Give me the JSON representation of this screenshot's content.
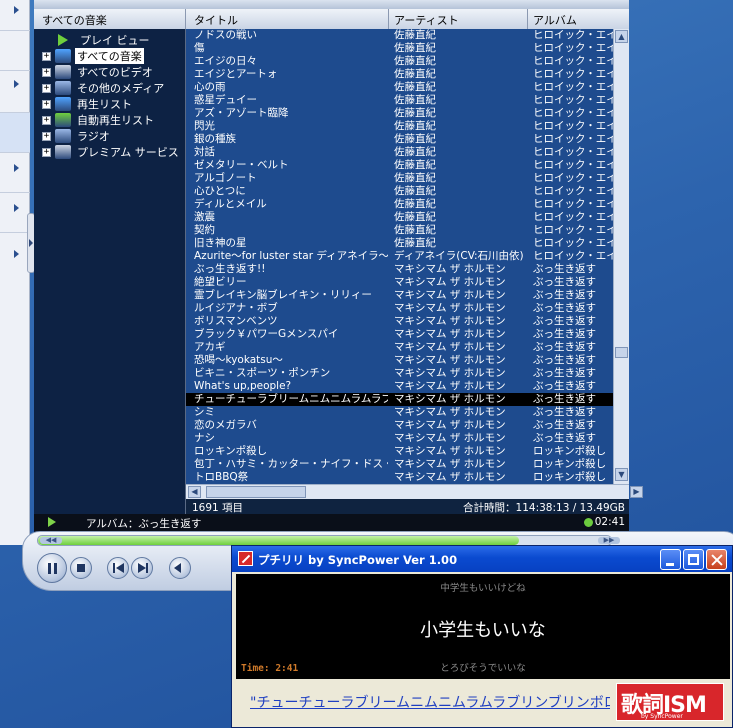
{
  "tree": {
    "header": "すべての音楽",
    "items": [
      {
        "label": "プレイ ビュー",
        "icon": "play-view-icon",
        "expand": false,
        "selected": false
      },
      {
        "label": "すべての音楽",
        "icon": "music-note-icon",
        "expand": true,
        "selected": true
      },
      {
        "label": "すべてのビデオ",
        "icon": "film-icon",
        "expand": true,
        "selected": false
      },
      {
        "label": "その他のメディア",
        "icon": "media-icon",
        "expand": true,
        "selected": false
      },
      {
        "label": "再生リスト",
        "icon": "playlist-icon",
        "expand": true,
        "selected": false
      },
      {
        "label": "自動再生リスト",
        "icon": "auto-playlist-icon",
        "expand": true,
        "selected": false
      },
      {
        "label": "ラジオ",
        "icon": "radio-icon",
        "expand": true,
        "selected": false
      },
      {
        "label": "プレミアム サービス",
        "icon": "premium-services-icon",
        "expand": true,
        "selected": false
      }
    ]
  },
  "columns": {
    "title": "タイトル",
    "artist": "アーティスト",
    "album": "アルバム"
  },
  "rows": [
    {
      "title": "ノドスの戦い",
      "artist": "佐藤直紀",
      "album": "ヒロイック・エイジ"
    },
    {
      "title": "傷",
      "artist": "佐藤直紀",
      "album": "ヒロイック・エイジ"
    },
    {
      "title": "エイジの日々",
      "artist": "佐藤直紀",
      "album": "ヒロイック・エイジ"
    },
    {
      "title": "エイジとアートォ",
      "artist": "佐藤直紀",
      "album": "ヒロイック・エイジ"
    },
    {
      "title": "心の雨",
      "artist": "佐藤直紀",
      "album": "ヒロイック・エイジ"
    },
    {
      "title": "惑星デュイー",
      "artist": "佐藤直紀",
      "album": "ヒロイック・エイジ"
    },
    {
      "title": "アズ・アゾート臨降",
      "artist": "佐藤直紀",
      "album": "ヒロイック・エイジ"
    },
    {
      "title": "閃光",
      "artist": "佐藤直紀",
      "album": "ヒロイック・エイジ"
    },
    {
      "title": "銀の種族",
      "artist": "佐藤直紀",
      "album": "ヒロイック・エイジ"
    },
    {
      "title": "対話",
      "artist": "佐藤直紀",
      "album": "ヒロイック・エイジ"
    },
    {
      "title": "ゼメタリー・ベルト",
      "artist": "佐藤直紀",
      "album": "ヒロイック・エイジ"
    },
    {
      "title": "アルゴノート",
      "artist": "佐藤直紀",
      "album": "ヒロイック・エイジ"
    },
    {
      "title": "心ひとつに",
      "artist": "佐藤直紀",
      "album": "ヒロイック・エイジ"
    },
    {
      "title": "ディルとメイル",
      "artist": "佐藤直紀",
      "album": "ヒロイック・エイジ"
    },
    {
      "title": "激震",
      "artist": "佐藤直紀",
      "album": "ヒロイック・エイジ"
    },
    {
      "title": "契約",
      "artist": "佐藤直紀",
      "album": "ヒロイック・エイジ"
    },
    {
      "title": "旧き神の星",
      "artist": "佐藤直紀",
      "album": "ヒロイック・エイジ"
    },
    {
      "title": "Azurite～for luster star ディアネイラ～",
      "artist": "ディアネイラ(CV:石川由依)",
      "album": "ヒロイック・エイジ"
    },
    {
      "title": "ぶっ生き返す!!",
      "artist": "マキシマム ザ ホルモン",
      "album": "ぶっ生き返す"
    },
    {
      "title": "絶望ビリー",
      "artist": "マキシマム ザ ホルモン",
      "album": "ぶっ生き返す"
    },
    {
      "title": "霊ブレイキン脳ブレイキン・リリィー",
      "artist": "マキシマム ザ ホルモン",
      "album": "ぶっ生き返す"
    },
    {
      "title": "ルイジアナ・ボブ",
      "artist": "マキシマム ザ ホルモン",
      "album": "ぶっ生き返す"
    },
    {
      "title": "ボリスマンベンツ",
      "artist": "マキシマム ザ ホルモン",
      "album": "ぶっ生き返す"
    },
    {
      "title": "ブラック￥パワーGメンスパイ",
      "artist": "マキシマム ザ ホルモン",
      "album": "ぶっ生き返す"
    },
    {
      "title": "アカギ",
      "artist": "マキシマム ザ ホルモン",
      "album": "ぶっ生き返す"
    },
    {
      "title": "恐喝～kyokatsu～",
      "artist": "マキシマム ザ ホルモン",
      "album": "ぶっ生き返す"
    },
    {
      "title": "ビキニ・スポーツ・ポンチン",
      "artist": "マキシマム ザ ホルモン",
      "album": "ぶっ生き返す"
    },
    {
      "title": "What's up,people?",
      "artist": "マキシマム ザ ホルモン",
      "album": "ぶっ生き返す"
    },
    {
      "title": "チューチューラブリームニムニムラムラブリ…",
      "artist": "マキシマム ザ ホルモン",
      "album": "ぶっ生き返す"
    },
    {
      "title": "シミ",
      "artist": "マキシマム ザ ホルモン",
      "album": "ぶっ生き返す"
    },
    {
      "title": "恋のメガラバ",
      "artist": "マキシマム ザ ホルモン",
      "album": "ぶっ生き返す"
    },
    {
      "title": "ナシ",
      "artist": "マキシマム ザ ホルモン",
      "album": "ぶっ生き返す"
    },
    {
      "title": "ロッキンポ殺し",
      "artist": "マキシマム ザ ホルモン",
      "album": "ロッキンポ殺し"
    },
    {
      "title": "包丁・ハサミ・カッター・ナイフ・ドス・キリ",
      "artist": "マキシマム ザ ホルモン",
      "album": "ロッキンポ殺し"
    },
    {
      "title": "トロBBQ祭",
      "artist": "マキシマム ザ ホルモン",
      "album": "ロッキンポ殺し"
    }
  ],
  "current_row": 28,
  "status": {
    "count": "1691 項目",
    "total": "合計時間：114:38:13 / 13.49GB"
  },
  "now_playing": {
    "info": "アルバム：ぶっ生き返す",
    "time": "02:41",
    "progress": 0.84
  },
  "popup": {
    "title": "プチリリ by SyncPower Ver 1.00",
    "prev_line": "中学生もいいけどね",
    "current_line": "小学生もいいな",
    "next_line": "とろびそうでいいな",
    "time": "Time: 2:41",
    "link": "\"チューチューラブリームニムニムラムラブリンブリンボロンヌ…",
    "logo_text": "歌詞ISM",
    "logo_sub": "by SyncPower"
  },
  "colors": {
    "grid_bg": "#1e4b8e",
    "current_row": "#000000",
    "progress": "#6fcf3d",
    "logo": "#d8262b"
  }
}
